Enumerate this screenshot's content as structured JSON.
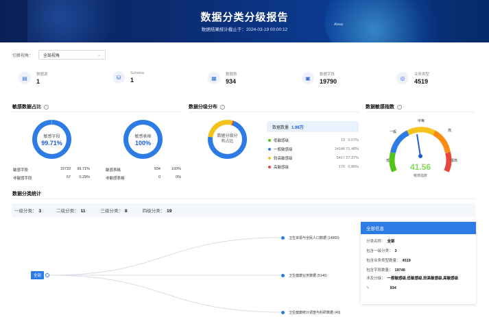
{
  "header": {
    "title": "数据分类分级报告",
    "subtitle": "数据结果统计截止于：2024-03-19 00:00:12",
    "tag": "Alway"
  },
  "filter": {
    "label": "切换视角：",
    "value": "全局视角"
  },
  "stats": [
    {
      "label": "数据源",
      "value": "1",
      "icon": "database-icon"
    },
    {
      "label": "Schema",
      "value": "1",
      "icon": "schema-icon"
    },
    {
      "label": "数据表",
      "value": "934",
      "icon": "table-icon"
    },
    {
      "label": "数据字段",
      "value": "19790",
      "icon": "field-icon"
    },
    {
      "label": "业务类型",
      "value": "4519",
      "icon": "business-icon"
    }
  ],
  "sensitive_ratio": {
    "title": "敏感数据占比",
    "field_donut": {
      "label": "敏感字段",
      "value": "99.71%",
      "fraction": 0.9971
    },
    "table_donut": {
      "label": "敏感表格",
      "value": "100%",
      "fraction": 1.0
    },
    "field_rows": [
      {
        "name": "敏感字段",
        "count": "19733",
        "pct": "99.71%"
      },
      {
        "name": "非敏感字段",
        "count": "57",
        "pct": "0.29%"
      }
    ],
    "table_rows": [
      {
        "name": "敏感表格",
        "count": "934",
        "pct": "100%"
      },
      {
        "name": "非敏感表格",
        "count": "0",
        "pct": "0%"
      }
    ]
  },
  "level_dist": {
    "title": "数据分级分布",
    "donut_label": "数据分级分布占比",
    "total_label": "数据数量",
    "total_value": "1.98万",
    "items": [
      {
        "name": "低敏感级",
        "count": "13",
        "pct": "0.07%",
        "color": "#52c41a"
      },
      {
        "name": "一般敏感级",
        "count": "14146",
        "pct": "71.48%",
        "color": "#2d7be5"
      },
      {
        "name": "较高敏感级",
        "count": "5417",
        "pct": "27.37%",
        "color": "#f5c31d"
      },
      {
        "name": "高敏感级",
        "count": "170",
        "pct": "0.86%",
        "color": "#e8453c"
      }
    ]
  },
  "sensitivity_index": {
    "title": "数据敏感指数",
    "value": "41.56",
    "caption": "敏感指数",
    "fraction": 0.4156,
    "labels": [
      "低",
      "一般",
      "中等",
      "高",
      "很高"
    ]
  },
  "classification": {
    "title": "数据分类统计",
    "levels": [
      {
        "label": "一级分类：",
        "value": "3"
      },
      {
        "label": "二级分类：",
        "value": "11"
      },
      {
        "label": "三级分类：",
        "value": "8"
      },
      {
        "label": "四级分类：",
        "value": "19"
      }
    ],
    "root": "全部",
    "children": [
      "卫生资源与全民人口数据 (14560)",
      "卫生健康业务数据 (5146)",
      "卫生健康统计调查与科研数据 (40)"
    ]
  },
  "info": {
    "title": "全部信息",
    "lines": [
      {
        "label": "分类名称：",
        "value": "全部"
      },
      {
        "label": "包含一级分类：",
        "value": "3"
      },
      {
        "label": "包含业务类型数量：",
        "value": "4519"
      },
      {
        "label": "包含字段数量：",
        "value": "19746"
      },
      {
        "label": "涉及分级：",
        "value": "一般敏感级,低敏感级,较高敏感级,高敏感级"
      },
      {
        "label": "",
        "value": "934"
      }
    ]
  }
}
